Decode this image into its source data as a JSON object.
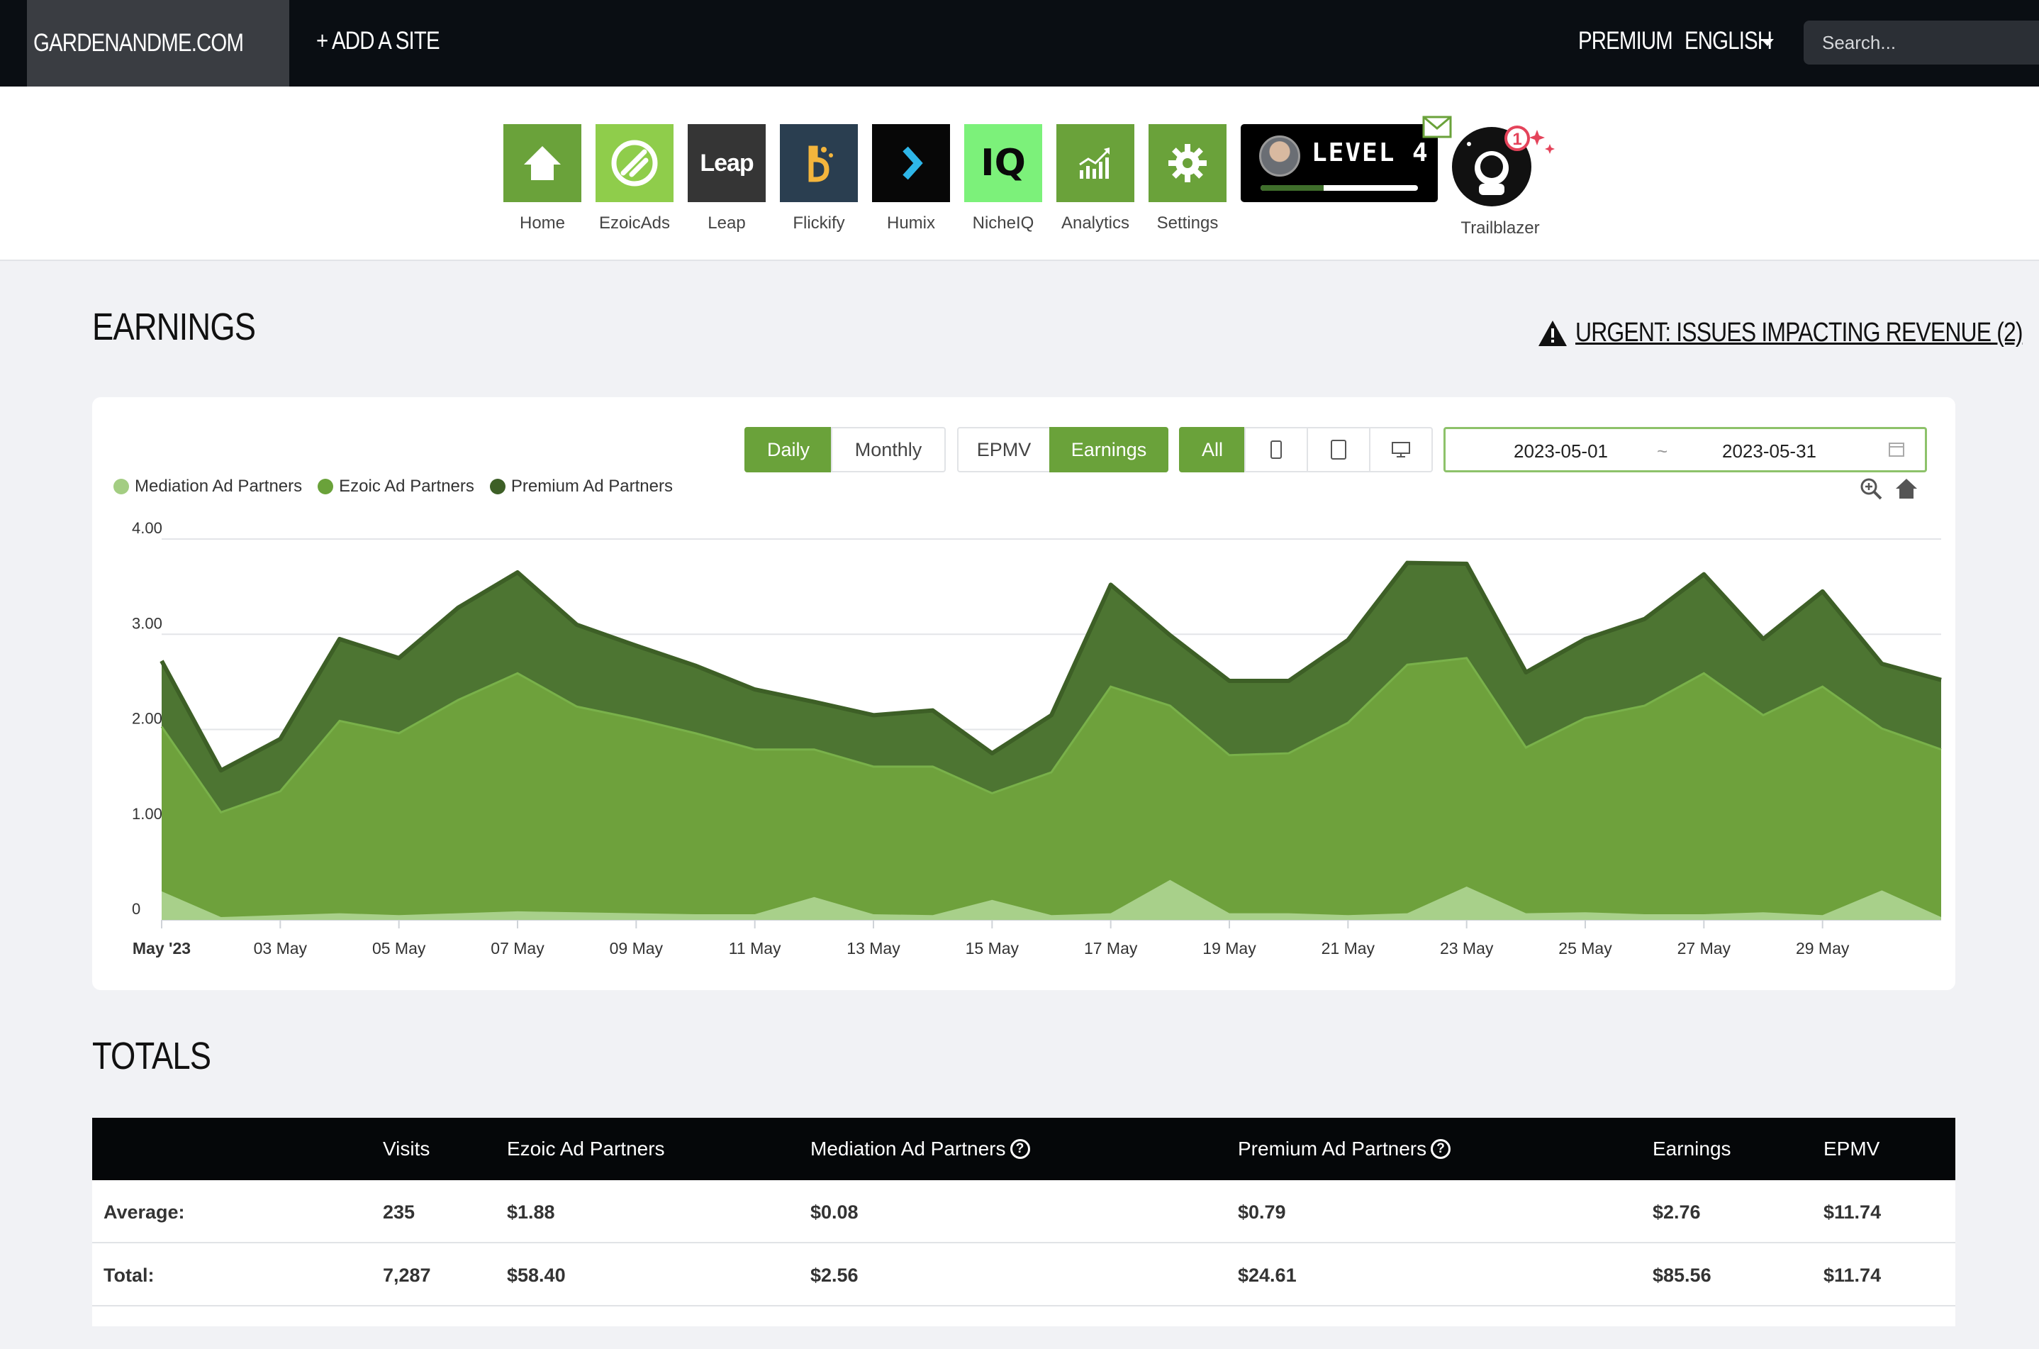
{
  "topbar": {
    "site": "GARDENANDME.COM",
    "add_site": "+ ADD A SITE",
    "premium": "PREMIUM",
    "language": "ENGLISH",
    "search_placeholder": "Search..."
  },
  "apps": [
    {
      "label": "Home",
      "color": "#6aa23a",
      "icon": "home-icon"
    },
    {
      "label": "EzoicAds",
      "color": "#8fcd4b",
      "icon": "ezoicads-icon"
    },
    {
      "label": "Leap",
      "color": "#353535",
      "icon": "leap-icon",
      "icon_text": "Leap"
    },
    {
      "label": "Flickify",
      "color": "#2a3e50",
      "icon": "flickify-icon"
    },
    {
      "label": "Humix",
      "color": "#070707",
      "icon": "humix-icon"
    },
    {
      "label": "NicheIQ",
      "color": "#7cf17a",
      "icon": "nicheiq-icon",
      "icon_text": "IQ"
    },
    {
      "label": "Analytics",
      "color": "#6aa23a",
      "icon": "analytics-icon"
    },
    {
      "label": "Settings",
      "color": "#6aa23a",
      "icon": "settings-icon"
    }
  ],
  "level_badge": {
    "text": "LEVEL 4",
    "progress_percent": 40
  },
  "trailblazer": {
    "label": "Trailblazer",
    "notification_count": "1"
  },
  "earnings": {
    "title": "EARNINGS",
    "urgent_link": "URGENT: ISSUES IMPACTING REVENUE (2)"
  },
  "controls": {
    "period": [
      {
        "label": "Daily",
        "active": true
      },
      {
        "label": "Monthly",
        "active": false
      }
    ],
    "metric": [
      {
        "label": "EPMV",
        "active": false
      },
      {
        "label": "Earnings",
        "active": true
      }
    ],
    "device": [
      {
        "label": "All",
        "active": true
      },
      {
        "icon": "mobile-icon"
      },
      {
        "icon": "tablet-icon"
      },
      {
        "icon": "desktop-icon"
      }
    ],
    "date_start": "2023-05-01",
    "date_sep": "~",
    "date_end": "2023-05-31"
  },
  "chart_data": {
    "type": "area",
    "stacked": true,
    "x": [
      "2023-05-01",
      "2023-05-02",
      "2023-05-03",
      "2023-05-04",
      "2023-05-05",
      "2023-05-06",
      "2023-05-07",
      "2023-05-08",
      "2023-05-09",
      "2023-05-10",
      "2023-05-11",
      "2023-05-12",
      "2023-05-13",
      "2023-05-14",
      "2023-05-15",
      "2023-05-16",
      "2023-05-17",
      "2023-05-18",
      "2023-05-19",
      "2023-05-20",
      "2023-05-21",
      "2023-05-22",
      "2023-05-23",
      "2023-05-24",
      "2023-05-25",
      "2023-05-26",
      "2023-05-27",
      "2023-05-28",
      "2023-05-29",
      "2023-05-30",
      "2023-05-31"
    ],
    "x_tick_labels": [
      "May '23",
      "03 May",
      "05 May",
      "07 May",
      "09 May",
      "11 May",
      "13 May",
      "15 May",
      "17 May",
      "19 May",
      "21 May",
      "23 May",
      "25 May",
      "27 May",
      "29 May"
    ],
    "y_ticks": [
      "0",
      "1.00",
      "2.00",
      "3.00",
      "4.00"
    ],
    "ylim": [
      0,
      4
    ],
    "grid": true,
    "legend_position": "top-left",
    "series": [
      {
        "name": "Mediation Ad Partners",
        "color": "#a3cd82",
        "values": [
          0.3,
          0.03,
          0.05,
          0.07,
          0.05,
          0.07,
          0.09,
          0.08,
          0.07,
          0.06,
          0.06,
          0.24,
          0.06,
          0.05,
          0.21,
          0.05,
          0.07,
          0.42,
          0.07,
          0.07,
          0.05,
          0.07,
          0.35,
          0.07,
          0.08,
          0.06,
          0.06,
          0.08,
          0.05,
          0.31,
          0.03
        ]
      },
      {
        "name": "Ezoic Ad Partners",
        "color": "#6aa23a",
        "values": [
          1.73,
          1.1,
          1.3,
          2.02,
          1.91,
          2.24,
          2.5,
          2.16,
          2.04,
          1.9,
          1.73,
          1.55,
          1.55,
          1.56,
          1.12,
          1.5,
          2.38,
          1.83,
          1.66,
          1.68,
          2.02,
          2.61,
          2.4,
          1.74,
          2.04,
          2.19,
          2.53,
          2.07,
          2.4,
          1.7,
          1.76
        ]
      },
      {
        "name": "Premium Ad Partners",
        "color": "#4b7430",
        "values": [
          0.69,
          0.44,
          0.55,
          0.86,
          0.79,
          0.97,
          1.06,
          0.86,
          0.77,
          0.71,
          0.63,
          0.5,
          0.54,
          0.59,
          0.42,
          0.6,
          1.07,
          0.74,
          0.78,
          0.76,
          0.87,
          1.07,
          0.99,
          0.79,
          0.83,
          0.91,
          1.04,
          0.8,
          1.0,
          0.68,
          0.73
        ]
      }
    ]
  },
  "totals": {
    "title": "TOTALS",
    "headers": [
      "",
      "Visits",
      "Ezoic Ad Partners",
      "Mediation Ad Partners",
      "Premium Ad Partners",
      "Earnings",
      "EPMV"
    ],
    "rows": [
      [
        "Average:",
        "235",
        "$1.88",
        "$0.08",
        "$0.79",
        "$2.76",
        "$11.74"
      ],
      [
        "Total:",
        "7,287",
        "$58.40",
        "$2.56",
        "$24.61",
        "$85.56",
        "$11.74"
      ]
    ]
  }
}
